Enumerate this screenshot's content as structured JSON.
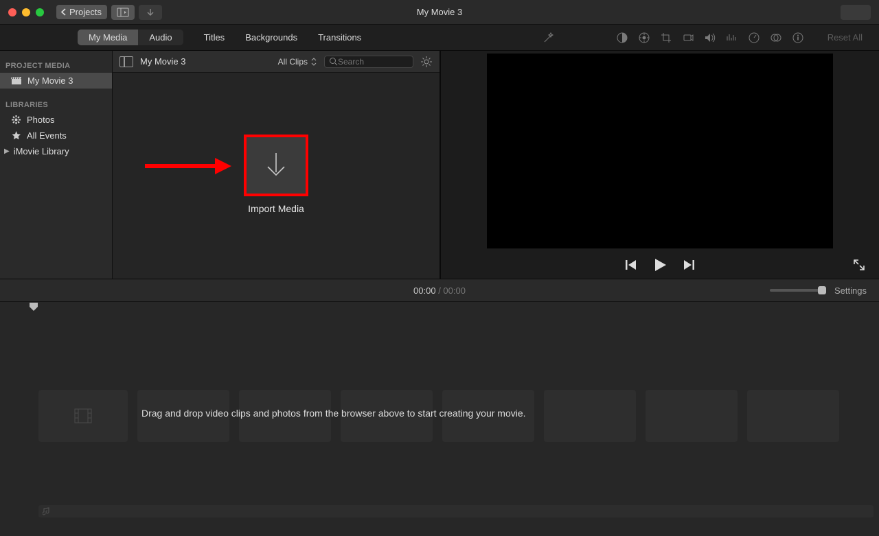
{
  "window": {
    "title": "My Movie 3"
  },
  "toolbar": {
    "projects_label": "Projects"
  },
  "tabs": {
    "my_media": "My Media",
    "audio": "Audio",
    "titles": "Titles",
    "backgrounds": "Backgrounds",
    "transitions": "Transitions",
    "reset_all": "Reset All"
  },
  "sidebar": {
    "project_media_heading": "PROJECT MEDIA",
    "project_item": "My Movie 3",
    "libraries_heading": "LIBRARIES",
    "photos": "Photos",
    "all_events": "All Events",
    "imovie_library": "iMovie Library"
  },
  "browser": {
    "event_title": "My Movie 3",
    "clips_filter": "All Clips",
    "search_placeholder": "Search",
    "import_label": "Import Media"
  },
  "timeline": {
    "current": "00:00",
    "sep": " / ",
    "total": "00:00",
    "settings": "Settings",
    "hint": "Drag and drop video clips and photos from the browser above to start creating your movie."
  }
}
